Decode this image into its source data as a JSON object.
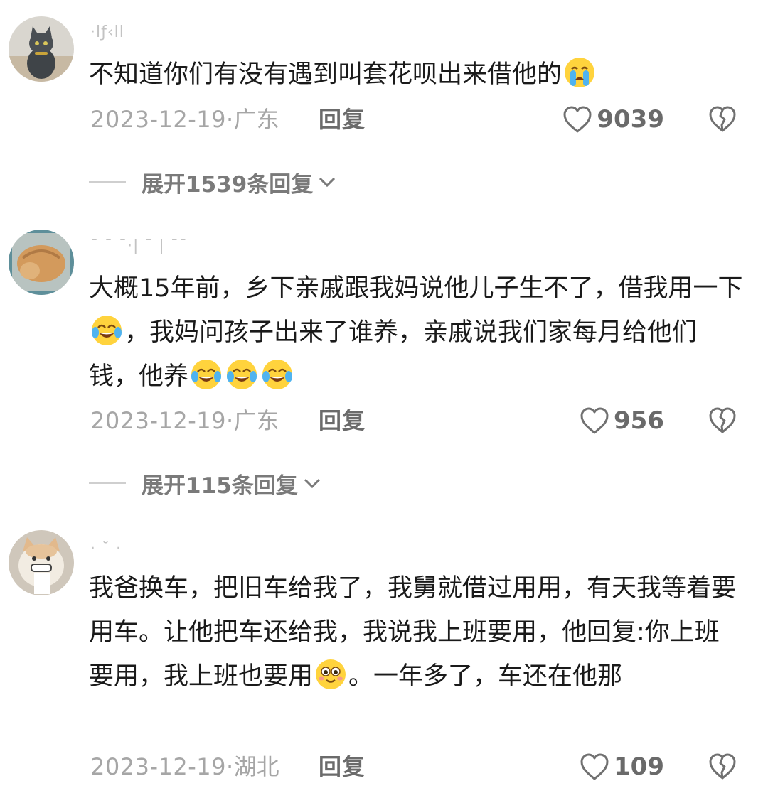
{
  "comments": [
    {
      "username": "·lƒ‹ll",
      "body": [
        {
          "t": "不知道你们有没有遇到叫套花呗出来借他的"
        },
        {
          "e": "loudly-crying-emoji"
        }
      ],
      "date": "2023-12-19·",
      "location": "广东",
      "reply_label": "回复",
      "likes": "9039",
      "expand_label": "展开1539条回复"
    },
    {
      "username": "ˉ ˉ ˉ·| ˉ | ˉˉ",
      "body": [
        {
          "t": "大概15年前，乡下亲戚跟我妈说他儿子生不了，借我用一下"
        },
        {
          "e": "tears-of-joy-emoji"
        },
        {
          "t": "，我妈问孩子出来了谁养，亲戚说我们家每月给他们钱，他养"
        },
        {
          "e": "tears-of-joy-emoji"
        },
        {
          "e": "tears-of-joy-emoji"
        },
        {
          "e": "tears-of-joy-emoji"
        }
      ],
      "date": "2023-12-19·",
      "location": "广东",
      "reply_label": "回复",
      "likes": "956",
      "expand_label": "展开115条回复"
    },
    {
      "username": "· ˘ ·",
      "body": [
        {
          "t": "我爸换车，把旧车给我了，我舅就借过用用，有天我等着要用车。让他把车还给我，我说我上班要用，他回复:你上班要用，我上班也要用"
        },
        {
          "e": "flushed-smile-emoji"
        },
        {
          "t": "。一年多了，车还在他那"
        }
      ],
      "date": "2023-12-19·",
      "location": "湖北",
      "reply_label": "回复",
      "likes": "109"
    }
  ],
  "icons": {
    "like": "heart-outline-icon",
    "dislike": "broken-heart-icon",
    "expand": "chevron-down-icon"
  },
  "colors": {
    "text": "#1a1a1a",
    "meta": "#a6a6a6",
    "reply": "#6b6b6b",
    "count": "#6a6a6a"
  }
}
